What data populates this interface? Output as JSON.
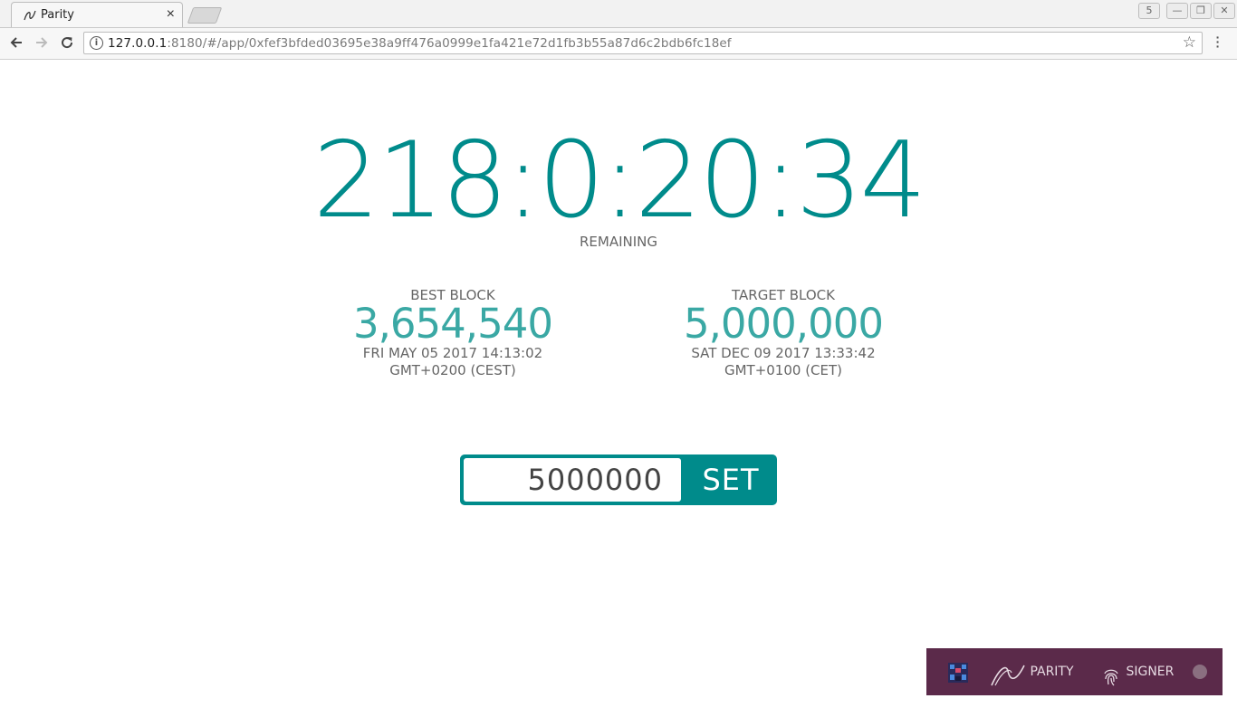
{
  "browser": {
    "tab_title": "Parity",
    "tab_close": "×",
    "extension_badge": "5",
    "url_host": "127.0.0.1",
    "url_rest": ":8180/#/app/0xfef3bfded03695e38a9ff476a0999e1fa421e72d1fb3b55a87d6c2bdb6fc18ef",
    "window_controls": [
      "—",
      "❐",
      "✕"
    ]
  },
  "main": {
    "countdown": "218:0:20:34",
    "remaining_label": "REMAINING",
    "best_block": {
      "label": "BEST BLOCK",
      "value": "3,654,540",
      "date_line1": "FRI MAY 05 2017 14:13:02",
      "date_line2": "GMT+0200 (CEST)"
    },
    "target_block": {
      "label": "TARGET BLOCK",
      "value": "5,000,000",
      "date_line1": "SAT DEC 09 2017 13:33:42",
      "date_line2": "GMT+0100 (CET)"
    },
    "input_value": "5000000",
    "set_label": "SET"
  },
  "statusbar": {
    "parity_label": "PARITY",
    "signer_label": "SIGNER"
  },
  "colors": {
    "accent": "#008b8b",
    "statusbar_bg": "#5b2a4a"
  }
}
